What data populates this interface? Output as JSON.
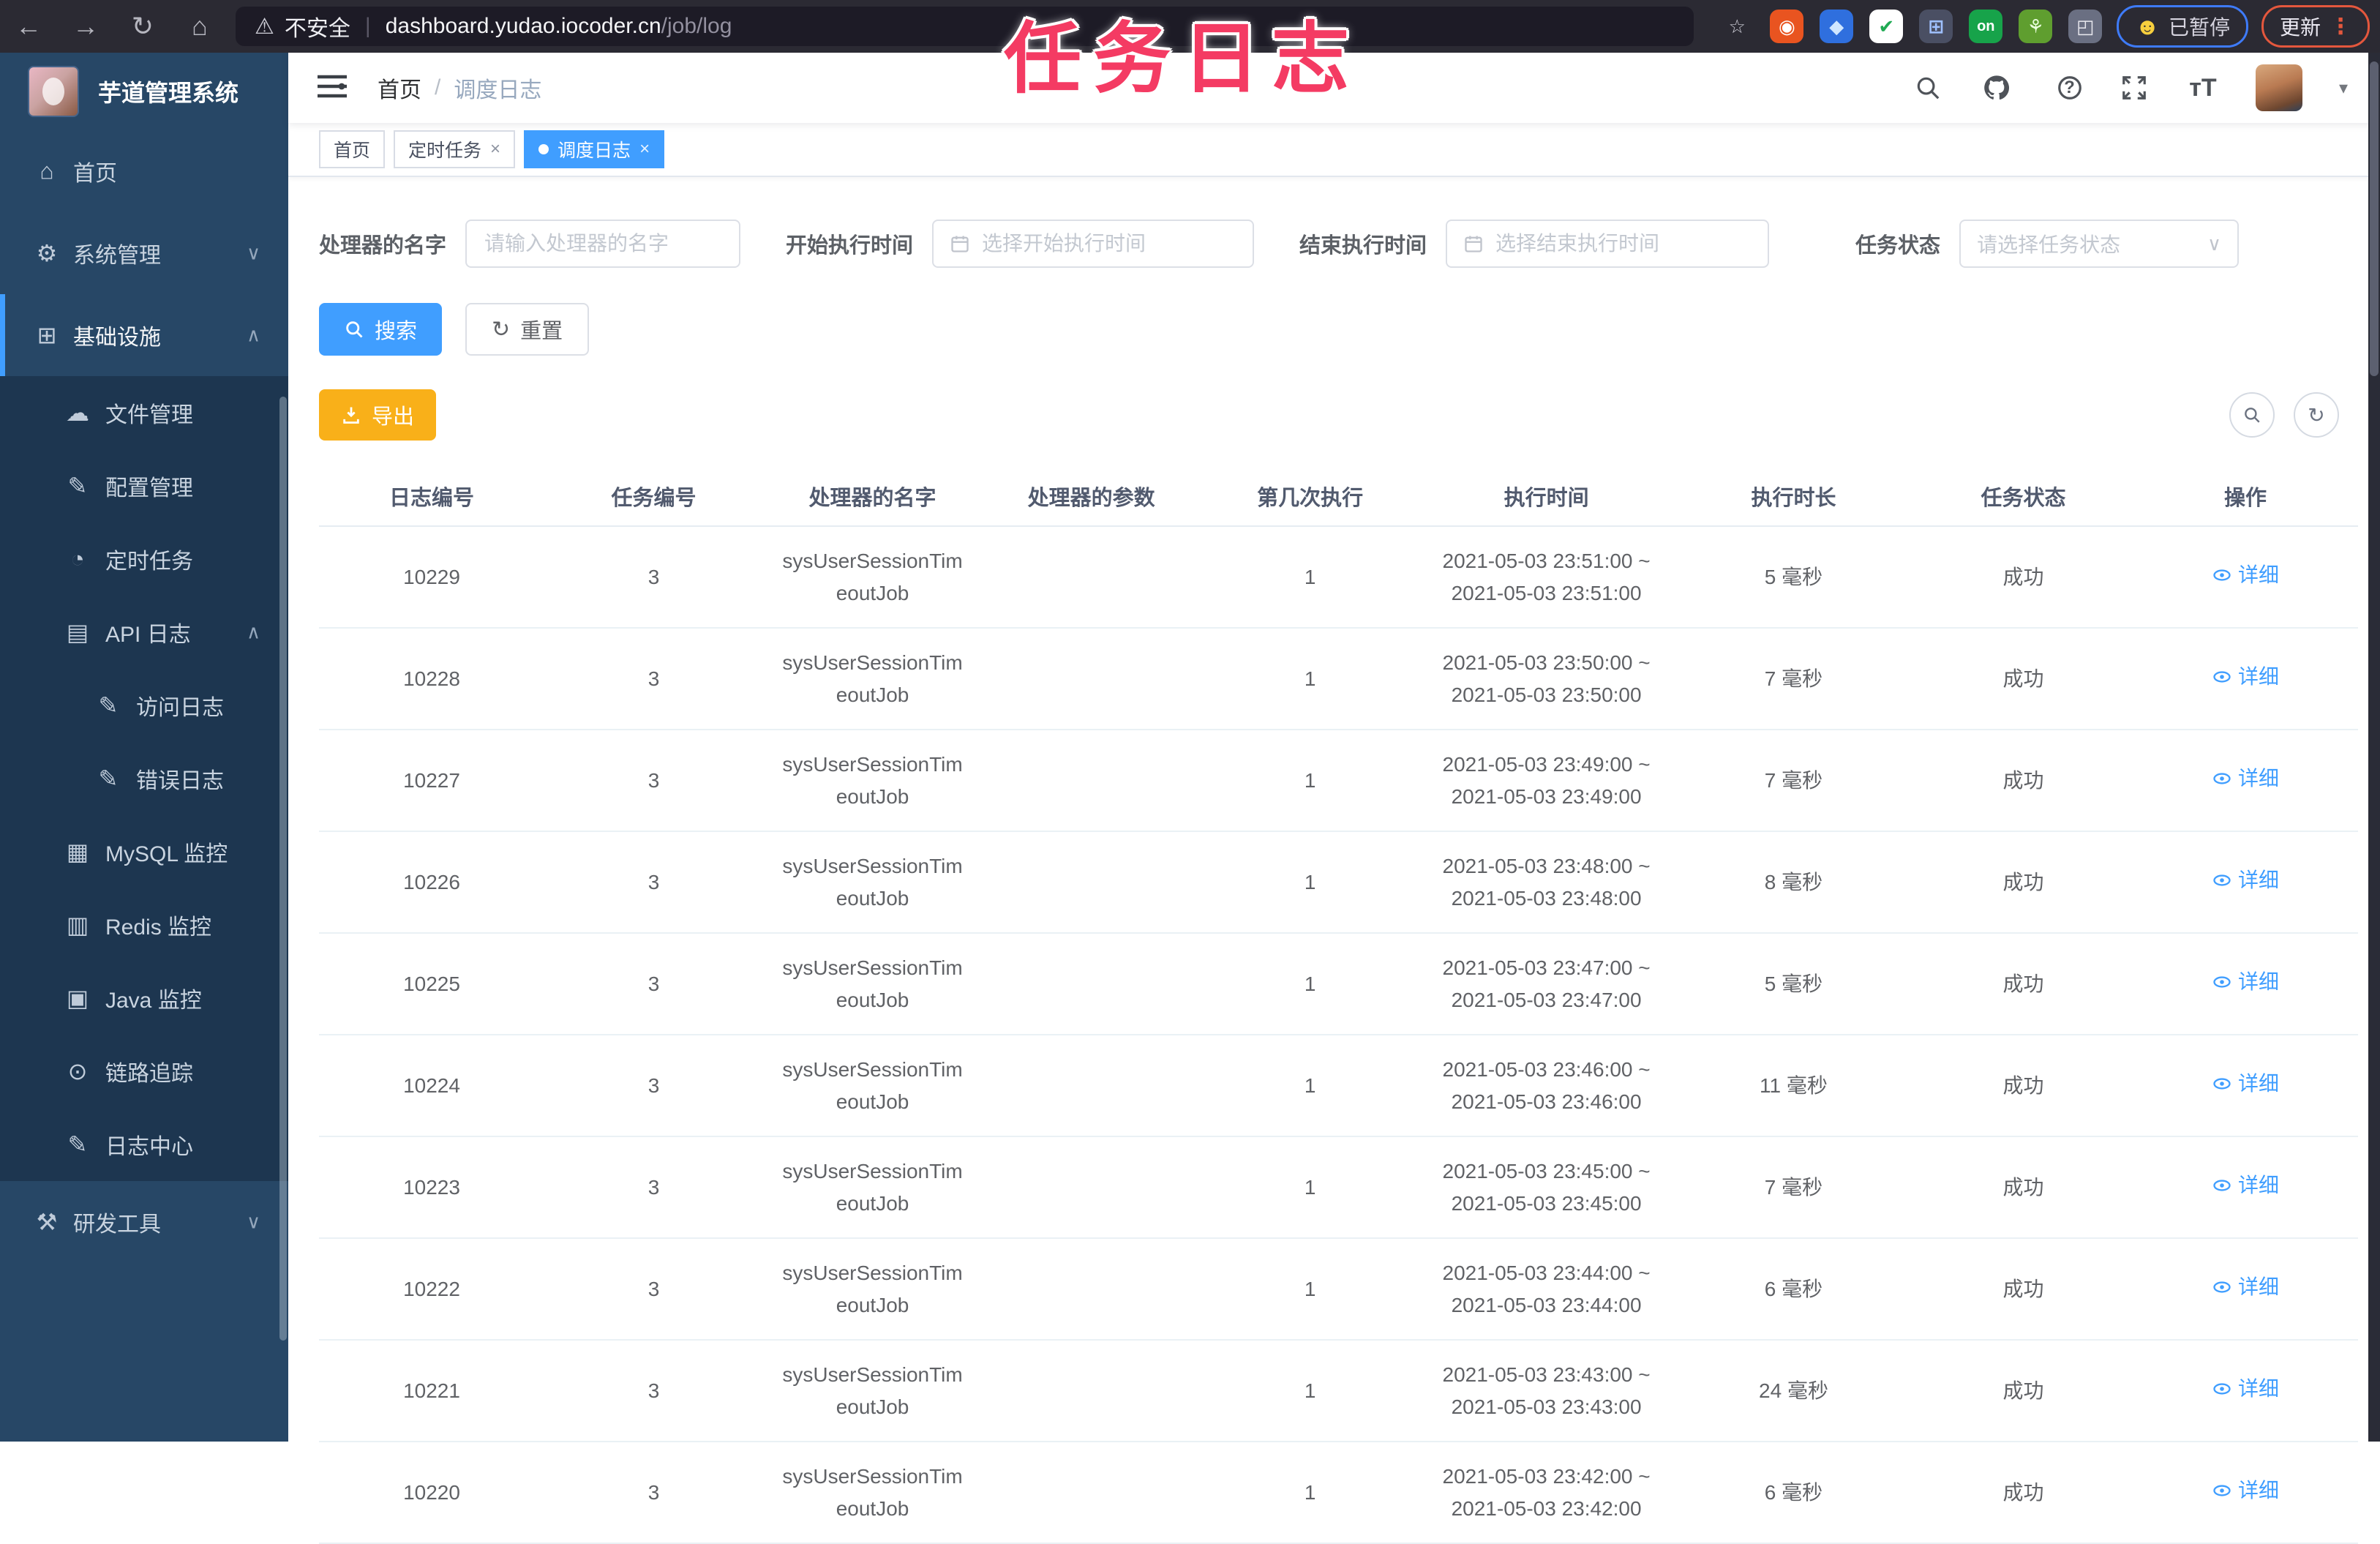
{
  "browser": {
    "security_label": "不安全",
    "url_host": "dashboard.yudao.iocoder.cn",
    "url_path": "/job/log",
    "paused_badge": "已暂停",
    "update_badge": "更新",
    "ext_icons": [
      {
        "name": "bookmark-star-icon",
        "glyph": "☆",
        "color": "#cfcfd8",
        "bg": "transparent"
      },
      {
        "name": "ext-orange-ring-icon",
        "glyph": "◉",
        "color": "#ffffff",
        "bg": "#e95420"
      },
      {
        "name": "ext-blue-gem-icon",
        "glyph": "◆",
        "color": "#cfe6ff",
        "bg": "#2f6fde"
      },
      {
        "name": "ext-green-check-icon",
        "glyph": "✔",
        "color": "#1faa53",
        "bg": "#ffffff"
      },
      {
        "name": "ext-grid-icon",
        "glyph": "⊞",
        "color": "#9fc0ff",
        "bg": "#4a4f63"
      },
      {
        "name": "ext-on-switch-icon",
        "glyph": "on",
        "color": "#ffffff",
        "bg": "#17a34a"
      },
      {
        "name": "ext-leaf-icon",
        "glyph": "⚘",
        "color": "#eaffdd",
        "bg": "#5f9e2f"
      },
      {
        "name": "ext-puzzle-icon",
        "glyph": "◰",
        "color": "#e8e8ee",
        "bg": "#6a6f82"
      }
    ]
  },
  "overlay_title": "任务日志",
  "sidebar": {
    "app_title": "芋道管理系统",
    "items": [
      {
        "id": "home",
        "label": "首页",
        "icon": "home-icon",
        "glyph": "⌂",
        "level": 1
      },
      {
        "id": "system-admin",
        "label": "系统管理",
        "icon": "gear-icon",
        "glyph": "⚙",
        "level": 1,
        "chevron": "down"
      },
      {
        "id": "infrastructure",
        "label": "基础设施",
        "icon": "monitor-icon",
        "glyph": "⊞",
        "level": 1,
        "chevron": "up",
        "active": true
      },
      {
        "id": "file-manage",
        "label": "文件管理",
        "icon": "cloud-upload-icon",
        "glyph": "☁",
        "level": 2,
        "sub": true
      },
      {
        "id": "config-manage",
        "label": "配置管理",
        "icon": "edit-icon",
        "glyph": "✎",
        "level": 2,
        "sub": true
      },
      {
        "id": "cron-job",
        "label": "定时任务",
        "icon": "timer-icon",
        "glyph": "◔",
        "level": 2,
        "sub": true
      },
      {
        "id": "api-log",
        "label": "API 日志",
        "icon": "log-icon",
        "glyph": "▤",
        "level": 2,
        "sub": true,
        "chevron": "up"
      },
      {
        "id": "access-log",
        "label": "访问日志",
        "icon": "doc-edit-icon",
        "glyph": "✎",
        "level": 3,
        "sub": true
      },
      {
        "id": "error-log",
        "label": "错误日志",
        "icon": "doc-edit-icon",
        "glyph": "✎",
        "level": 3,
        "sub": true
      },
      {
        "id": "mysql-monitor",
        "label": "MySQL 监控",
        "icon": "database-icon",
        "glyph": "▦",
        "level": 2,
        "sub": true
      },
      {
        "id": "redis-monitor",
        "label": "Redis 监控",
        "icon": "stack-icon",
        "glyph": "▥",
        "level": 2,
        "sub": true
      },
      {
        "id": "java-monitor",
        "label": "Java 监控",
        "icon": "screen-icon",
        "glyph": "▣",
        "level": 2,
        "sub": true
      },
      {
        "id": "trace",
        "label": "链路追踪",
        "icon": "eye-icon",
        "glyph": "⊙",
        "level": 2,
        "sub": true
      },
      {
        "id": "log-center",
        "label": "日志中心",
        "icon": "log-edit-icon",
        "glyph": "✎",
        "level": 2,
        "sub": true
      },
      {
        "id": "dev-tools",
        "label": "研发工具",
        "icon": "toolbox-icon",
        "glyph": "⚒",
        "level": 1,
        "chevron": "down"
      }
    ]
  },
  "header": {
    "breadcrumb": [
      "首页",
      "调度日志"
    ],
    "breadcrumb_sep": "/"
  },
  "tags": {
    "items": [
      {
        "label": "首页",
        "closable": false,
        "active": false
      },
      {
        "label": "定时任务",
        "closable": true,
        "active": false
      },
      {
        "label": "调度日志",
        "closable": true,
        "active": true
      }
    ]
  },
  "filters": {
    "handler_name_label": "处理器的名字",
    "handler_name_placeholder": "请输入处理器的名字",
    "start_time_label": "开始执行时间",
    "start_time_placeholder": "选择开始执行时间",
    "end_time_label": "结束执行时间",
    "end_time_placeholder": "选择结束执行时间",
    "status_label": "任务状态",
    "status_placeholder": "请选择任务状态"
  },
  "actions": {
    "search_label": "搜索",
    "reset_label": "重置",
    "export_label": "导出"
  },
  "table": {
    "columns": [
      "日志编号",
      "任务编号",
      "处理器的名字",
      "处理器的参数",
      "第几次执行",
      "执行时间",
      "执行时长",
      "任务状态",
      "操作"
    ],
    "action_label": "详细",
    "rows": [
      {
        "log_id": "10229",
        "job_id": "3",
        "handler_line1": "sysUserSessionTim",
        "handler_line2": "eoutJob",
        "param": "",
        "count": "1",
        "time_start": "2021-05-03 23:51:00 ~",
        "time_end": "2021-05-03 23:51:00",
        "duration": "5 毫秒",
        "status": "成功"
      },
      {
        "log_id": "10228",
        "job_id": "3",
        "handler_line1": "sysUserSessionTim",
        "handler_line2": "eoutJob",
        "param": "",
        "count": "1",
        "time_start": "2021-05-03 23:50:00 ~",
        "time_end": "2021-05-03 23:50:00",
        "duration": "7 毫秒",
        "status": "成功"
      },
      {
        "log_id": "10227",
        "job_id": "3",
        "handler_line1": "sysUserSessionTim",
        "handler_line2": "eoutJob",
        "param": "",
        "count": "1",
        "time_start": "2021-05-03 23:49:00 ~",
        "time_end": "2021-05-03 23:49:00",
        "duration": "7 毫秒",
        "status": "成功"
      },
      {
        "log_id": "10226",
        "job_id": "3",
        "handler_line1": "sysUserSessionTim",
        "handler_line2": "eoutJob",
        "param": "",
        "count": "1",
        "time_start": "2021-05-03 23:48:00 ~",
        "time_end": "2021-05-03 23:48:00",
        "duration": "8 毫秒",
        "status": "成功"
      },
      {
        "log_id": "10225",
        "job_id": "3",
        "handler_line1": "sysUserSessionTim",
        "handler_line2": "eoutJob",
        "param": "",
        "count": "1",
        "time_start": "2021-05-03 23:47:00 ~",
        "time_end": "2021-05-03 23:47:00",
        "duration": "5 毫秒",
        "status": "成功"
      },
      {
        "log_id": "10224",
        "job_id": "3",
        "handler_line1": "sysUserSessionTim",
        "handler_line2": "eoutJob",
        "param": "",
        "count": "1",
        "time_start": "2021-05-03 23:46:00 ~",
        "time_end": "2021-05-03 23:46:00",
        "duration": "11 毫秒",
        "status": "成功"
      },
      {
        "log_id": "10223",
        "job_id": "3",
        "handler_line1": "sysUserSessionTim",
        "handler_line2": "eoutJob",
        "param": "",
        "count": "1",
        "time_start": "2021-05-03 23:45:00 ~",
        "time_end": "2021-05-03 23:45:00",
        "duration": "7 毫秒",
        "status": "成功"
      },
      {
        "log_id": "10222",
        "job_id": "3",
        "handler_line1": "sysUserSessionTim",
        "handler_line2": "eoutJob",
        "param": "",
        "count": "1",
        "time_start": "2021-05-03 23:44:00 ~",
        "time_end": "2021-05-03 23:44:00",
        "duration": "6 毫秒",
        "status": "成功"
      },
      {
        "log_id": "10221",
        "job_id": "3",
        "handler_line1": "sysUserSessionTim",
        "handler_line2": "eoutJob",
        "param": "",
        "count": "1",
        "time_start": "2021-05-03 23:43:00 ~",
        "time_end": "2021-05-03 23:43:00",
        "duration": "24 毫秒",
        "status": "成功"
      },
      {
        "log_id": "10220",
        "job_id": "3",
        "handler_line1": "sysUserSessionTim",
        "handler_line2": "eoutJob",
        "param": "",
        "count": "1",
        "time_start": "2021-05-03 23:42:00 ~",
        "time_end": "2021-05-03 23:42:00",
        "duration": "6 毫秒",
        "status": "成功"
      }
    ]
  },
  "colors": {
    "accent_blue": "#409eff",
    "export_orange": "#f9b019",
    "overlay_pink": "#f43b63",
    "sidebar_bg": "#274766",
    "sidebar_sub_bg": "#1d3650"
  }
}
